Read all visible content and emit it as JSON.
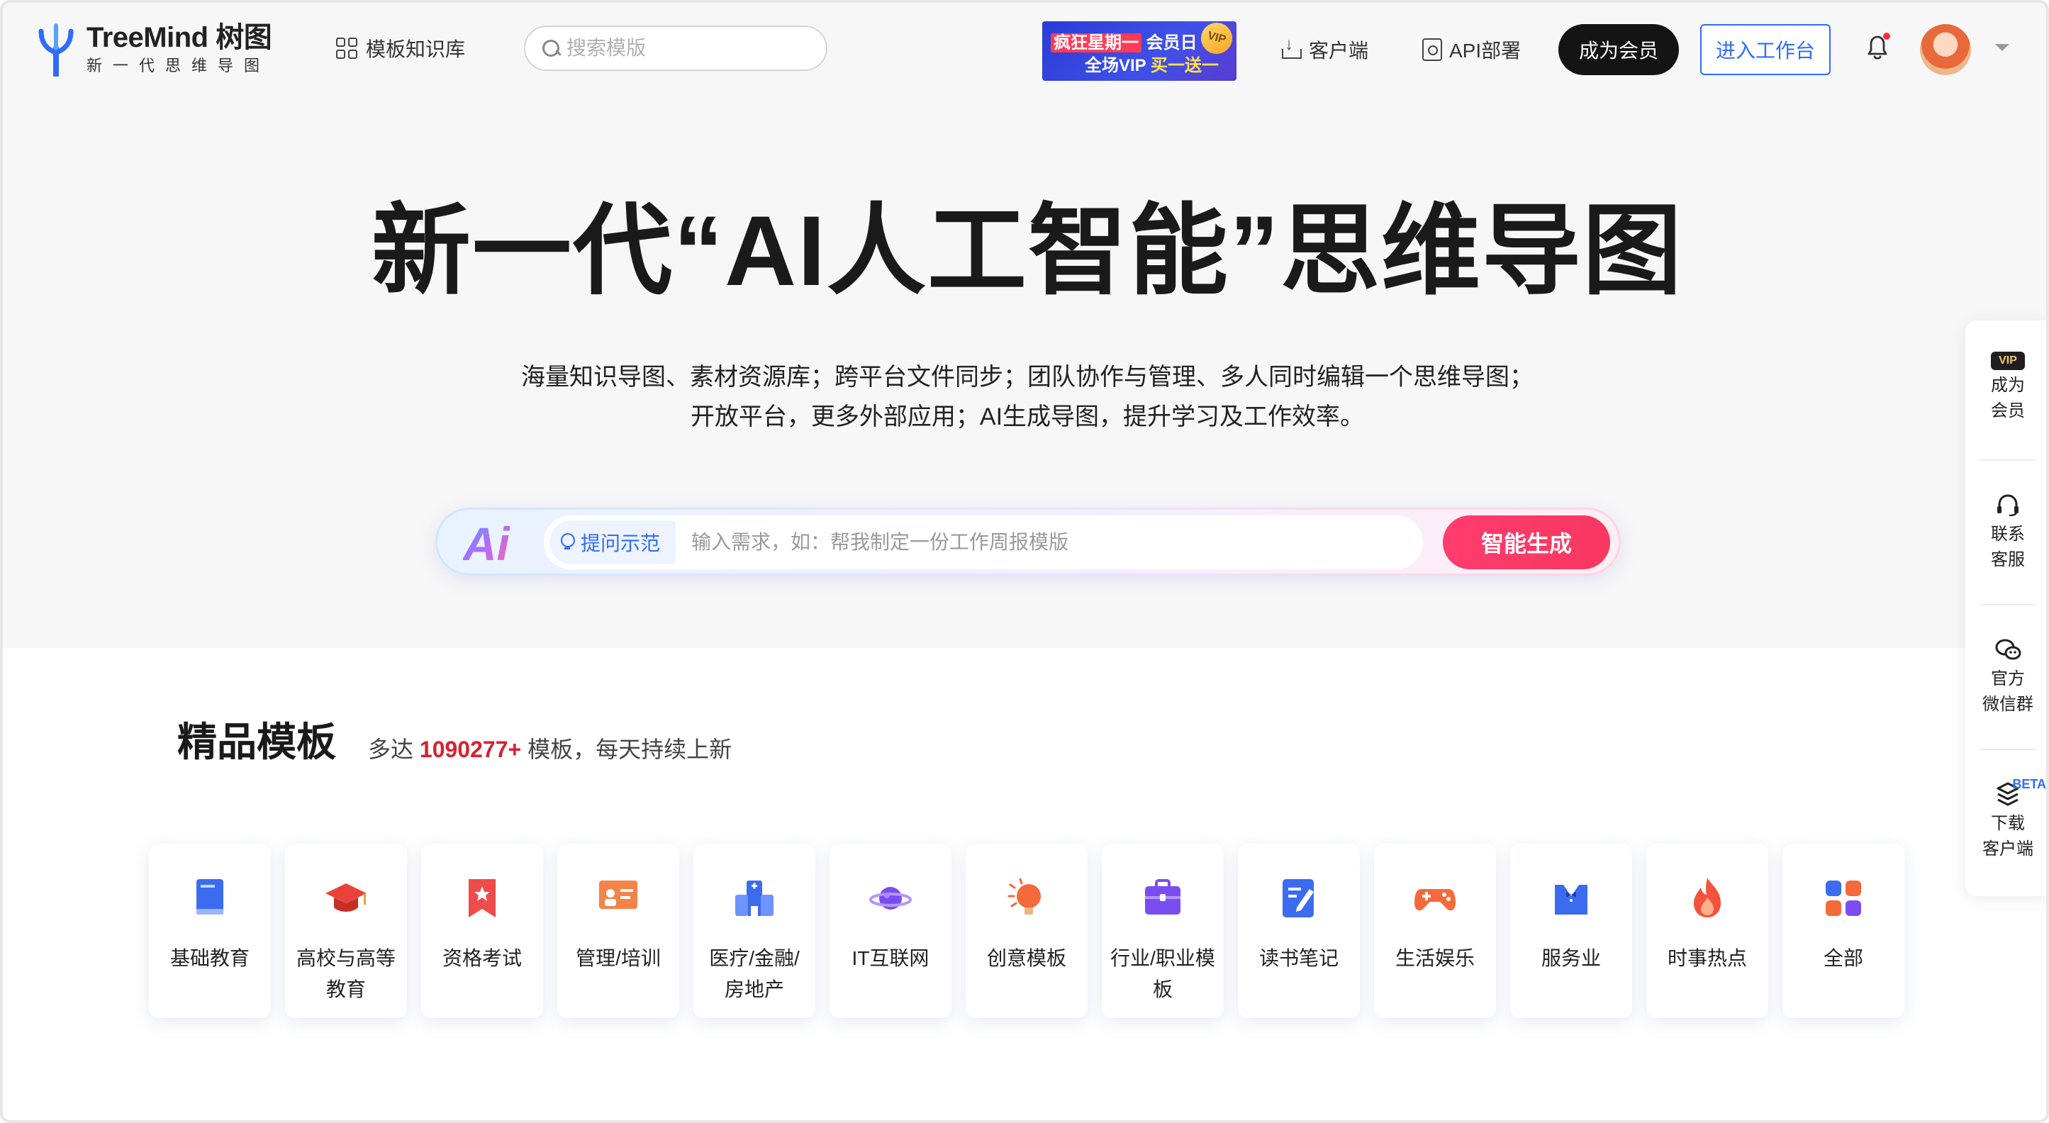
{
  "header": {
    "logo_title": "TreeMind 树图",
    "logo_subtitle": "新一代思维导图",
    "kb_label": "模板知识库",
    "search_placeholder": "搜索模版",
    "promo": {
      "line1_hot": "疯狂星期一",
      "line1_rest": "会员日",
      "line2_a": "全场VIP",
      "line2_b": "买一送一",
      "badge": "VIP"
    },
    "client_label": "客户端",
    "api_label": "API部署",
    "member_button": "成为会员",
    "workbench_button": "进入工作台"
  },
  "hero": {
    "title": "新一代“AI人工智能”思维导图",
    "desc_line1": "海量知识导图、素材资源库；跨平台文件同步；团队协作与管理、多人同时编辑一个思维导图；",
    "desc_line2": "开放平台，更多外部应用；AI生成导图，提升学习及工作效率。",
    "ai_logo": "Ai",
    "example_label": "提问示范",
    "input_placeholder": "输入需求，如：帮我制定一份工作周报模版",
    "generate_button": "智能生成"
  },
  "section": {
    "title": "精品模板",
    "sub_prefix": "多达",
    "count": "1090277+",
    "sub_suffix": "模板，每天持续上新"
  },
  "categories": [
    {
      "label": "基础教育",
      "icon": "book-icon"
    },
    {
      "label": "高校与高等教育",
      "icon": "graduation-cap-icon"
    },
    {
      "label": "资格考试",
      "icon": "bookmark-star-icon"
    },
    {
      "label": "管理/培训",
      "icon": "presentation-board-icon"
    },
    {
      "label": "医疗/金融/房地产",
      "icon": "building-icon"
    },
    {
      "label": "IT互联网",
      "icon": "planet-icon"
    },
    {
      "label": "创意模板",
      "icon": "lightbulb-icon"
    },
    {
      "label": "行业/职业模板",
      "icon": "briefcase-icon"
    },
    {
      "label": "读书笔记",
      "icon": "note-pen-icon"
    },
    {
      "label": "生活娱乐",
      "icon": "gamepad-icon"
    },
    {
      "label": "服务业",
      "icon": "waiter-icon"
    },
    {
      "label": "时事热点",
      "icon": "fire-icon"
    },
    {
      "label": "全部",
      "icon": "apps-grid-icon"
    }
  ],
  "sidebar": {
    "vip_badge": "VIP",
    "member_l1": "成为",
    "member_l2": "会员",
    "service_l1": "联系",
    "service_l2": "客服",
    "wechat_l1": "官方",
    "wechat_l2": "微信群",
    "beta": "BETA",
    "download_l1": "下载",
    "download_l2": "客户端"
  },
  "colors": {
    "accent_blue": "#2f6bff",
    "generate_red": "#f7385f",
    "count_red": "#d8202f"
  }
}
